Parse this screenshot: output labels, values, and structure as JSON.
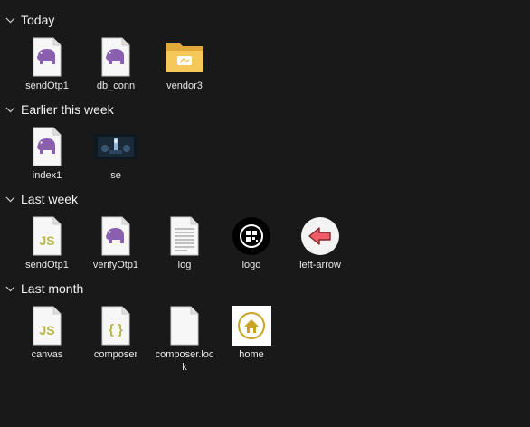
{
  "groups": [
    {
      "title": "Today",
      "items": [
        {
          "name": "sendOtp1",
          "type": "php"
        },
        {
          "name": "db_conn",
          "type": "php"
        },
        {
          "name": "vendor3",
          "type": "folder"
        }
      ]
    },
    {
      "title": "Earlier this week",
      "items": [
        {
          "name": "index1",
          "type": "php"
        },
        {
          "name": "se",
          "type": "image-dark"
        }
      ]
    },
    {
      "title": "Last week",
      "items": [
        {
          "name": "sendOtp1",
          "type": "js"
        },
        {
          "name": "verifyOtp1",
          "type": "php"
        },
        {
          "name": "log",
          "type": "text"
        },
        {
          "name": "logo",
          "type": "image-logo"
        },
        {
          "name": "left-arrow",
          "type": "image-arrow"
        }
      ]
    },
    {
      "title": "Last month",
      "items": [
        {
          "name": "canvas",
          "type": "js"
        },
        {
          "name": "composer",
          "type": "json"
        },
        {
          "name": "composer.lock",
          "type": "blank"
        },
        {
          "name": "home",
          "type": "image-home"
        }
      ]
    }
  ],
  "icons": {
    "php": "php-elephant-icon",
    "folder": "folder-icon",
    "image-dark": "image-thumbnail-icon",
    "js": "js-file-icon",
    "text": "text-file-icon",
    "image-logo": "logo-thumbnail-icon",
    "image-arrow": "left-arrow-thumbnail-icon",
    "json": "json-file-icon",
    "blank": "blank-file-icon",
    "image-home": "home-thumbnail-icon"
  },
  "colors": {
    "background": "#191919",
    "php_purple": "#8a5fb0",
    "js_green": "#b8b84a",
    "folder_yellow": "#f2c04a",
    "arrow_red": "#ef5c67",
    "home_gold": "#c9a227"
  }
}
